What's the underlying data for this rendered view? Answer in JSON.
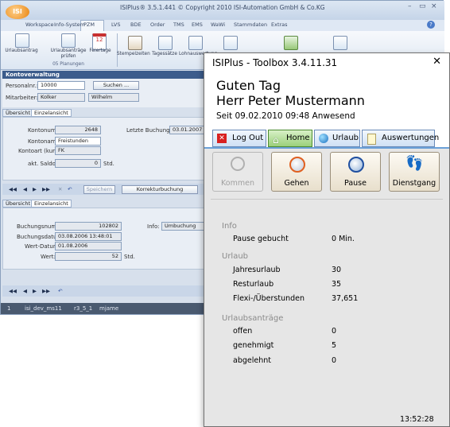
{
  "app": {
    "title": "ISIPlus® 3.5.1.441   © Copyright 2010  ISI-Automation GmbH & Co.KG",
    "logo_text": "ISI",
    "menu_tabs": [
      "Workspace",
      "Info-System",
      "PZM",
      "LVS",
      "BDE",
      "Order",
      "TMS",
      "EMS",
      "WaWi",
      "Stammdaten",
      "Extras"
    ],
    "ribbon": {
      "left_items": [
        "Urlaubsantrag",
        "Urlaubsanträge prüfen",
        "Feiertage"
      ],
      "group_label": "05 Planungen",
      "right_items": [
        "Stempelzeiten",
        "Tagessätze",
        "Lohnauswertung",
        "Tagesauswertung",
        "Abwesenheitserfassung",
        "Kontoverwaltung"
      ]
    }
  },
  "konto": {
    "header": "Kontoverwaltung",
    "personalnr_label": "Personalnr.:",
    "personalnr_value": "10000",
    "suchen_label": "Suchen ...",
    "mitarbeiter_label": "Mitarbeiter:",
    "mitarbeiter_last": "Kolker",
    "mitarbeiter_first": "Wilhelm",
    "tabs": [
      "Übersicht",
      "Einzelansicht"
    ],
    "kontonummer_label": "Kontonummer:",
    "kontonummer_value": "2648",
    "kontoname_label": "Kontoname:",
    "kontoname_value": "Freistunden",
    "kontoart_label": "Kontoart (kurz):",
    "kontoart_value": "FK",
    "saldo_label": "akt. Saldo:",
    "saldo_value": "0",
    "saldo_unit": "Std.",
    "letzte_label": "Letzte Buchung am:",
    "letzte_value": "03.01.2007 13:3",
    "speichern_label": "Speichern",
    "korrektur_label": "Korrekturbuchung"
  },
  "buchung": {
    "tabs": [
      "Übersicht",
      "Einzelansicht"
    ],
    "nummer_label": "Buchungsnummer:",
    "nummer_value": "102802",
    "datum_label": "Buchungsdatum:",
    "datum_value": "03.08.2006 13:48:01",
    "wert_datum_label": "Wert-Datum:",
    "wert_datum_value": "01.08.2006",
    "wert_label": "Wert:",
    "wert_value": "52",
    "wert_unit": "Std.",
    "info_label": "Info:",
    "info_value": "Umbuchung auf Fle"
  },
  "status_bar": [
    "1",
    "isi_dev_ms11",
    "r3_5_1",
    "mjame"
  ],
  "toolbox": {
    "title": "ISIPlus - Toolbox 3.4.11.31",
    "close": "✕",
    "greeting_line1": "Guten Tag",
    "greeting_line2": "Herr Peter Mustermann",
    "since": "Seit 09.02.2010 09:48 Anwesend",
    "tabs": {
      "logout": "Log Out",
      "home": "Home",
      "urlaub": "Urlaub",
      "auswertungen": "Auswertungen"
    },
    "actions": {
      "kommen": "Kommen",
      "gehen": "Gehen",
      "pause": "Pause",
      "dienstgang": "Dienstgang"
    },
    "info": {
      "title": "Info",
      "pause_label": "Pause gebucht",
      "pause_value": "0 Min."
    },
    "urlaub": {
      "title": "Urlaub",
      "jahres_label": "Jahresurlaub",
      "jahres_value": "30",
      "rest_label": "Resturlaub",
      "rest_value": "35",
      "flexi_label": "Flexi-/Überstunden",
      "flexi_value": "37,651"
    },
    "antraege": {
      "title": "Urlaubsanträge",
      "offen_label": "offen",
      "offen_value": "0",
      "genehmigt_label": "genehmigt",
      "genehmigt_value": "5",
      "abgelehnt_label": "abgelehnt",
      "abgelehnt_value": "0"
    },
    "clock": "13:52:28"
  }
}
